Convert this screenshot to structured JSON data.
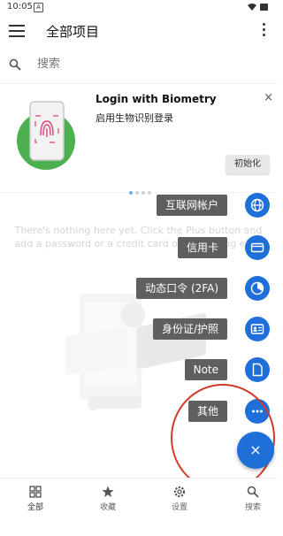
{
  "status_bar": {
    "time": "10:05",
    "sim_glyph": "A"
  },
  "app_bar": {
    "title": "全部项目"
  },
  "search": {
    "placeholder": "搜索"
  },
  "banner": {
    "title": "Login with Biometry",
    "subtitle": "启用生物识别登录",
    "button_label": "初始化",
    "close_glyph": "×",
    "page_count": 4,
    "active_page": 1
  },
  "empty_state": {
    "text": "There's nothing here yet. Click the Plus button and add a password or a credit card or something else."
  },
  "fab_menu": {
    "items": [
      {
        "label": "互联网帐户",
        "icon": "globe-icon"
      },
      {
        "label": "信用卡",
        "icon": "credit-card-icon"
      },
      {
        "label": "动态口令 (2FA)",
        "icon": "timer-icon"
      },
      {
        "label": "身份证/护照",
        "icon": "id-card-icon"
      },
      {
        "label": "Note",
        "icon": "note-icon"
      },
      {
        "label": "其他",
        "icon": "more-dots-icon"
      }
    ],
    "close_glyph": "×"
  },
  "bottom_nav": {
    "items": [
      {
        "label": "全部",
        "icon": "grid-icon"
      },
      {
        "label": "收藏",
        "icon": "star-icon"
      },
      {
        "label": "设置",
        "icon": "gear-icon"
      },
      {
        "label": "搜索",
        "icon": "search-icon"
      }
    ]
  },
  "colors": {
    "accent": "#1e70d8",
    "highlight_circle": "#d23b2b",
    "label_bg": "#5f5f5f"
  }
}
